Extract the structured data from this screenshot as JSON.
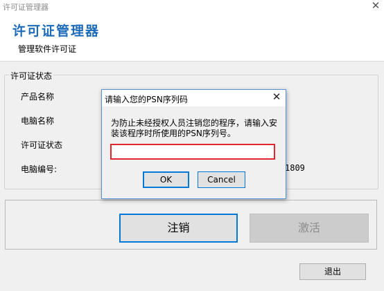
{
  "window": {
    "title": "许可证管理器",
    "close_glyph": "✕"
  },
  "header": {
    "app_title": "许可证管理器",
    "subtitle": "管理软件许可证"
  },
  "status_group": {
    "legend": "许可证状态",
    "product_label": "产品名称",
    "computer_name_label": "电脑名称",
    "license_status_label": "许可证状态",
    "computer_number_label": "电脑编号:",
    "computer_number_visible": "1809"
  },
  "actions": {
    "deregister_label": "注销",
    "activate_label": "激活",
    "exit_label": "退出"
  },
  "dialog": {
    "title": "请输入您的PSN序列码",
    "close_glyph": "✕",
    "message": "为防止未经授权人员注销您的程序，请输入安装该程序时所使用的PSN序列号。",
    "input_value": "",
    "ok_label": "OK",
    "cancel_label": "Cancel"
  },
  "colors": {
    "accent_blue": "#0078d7",
    "title_blue": "#1c6bb8",
    "input_error_red": "#e3262b"
  }
}
